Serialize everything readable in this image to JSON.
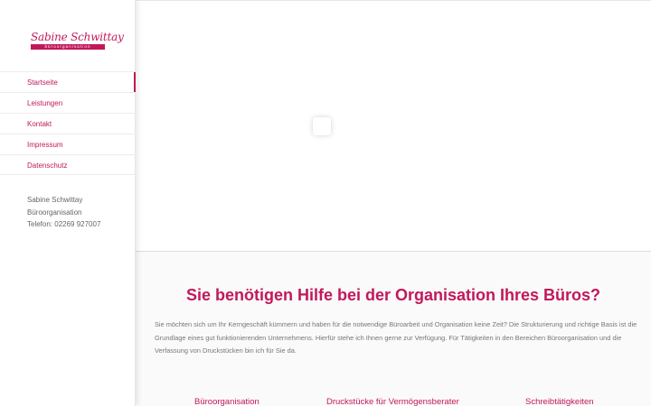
{
  "brand": {
    "name": "Sabine Schwittay",
    "tagline": "büroorganisation"
  },
  "nav": {
    "items": [
      {
        "label": "Startseite",
        "active": true
      },
      {
        "label": "Leistungen",
        "active": false
      },
      {
        "label": "Kontakt",
        "active": false
      },
      {
        "label": "Impressum",
        "active": false
      },
      {
        "label": "Datenschutz",
        "active": false
      }
    ]
  },
  "contact": {
    "name": "Sabine Schwittay",
    "title": "Büroorganisation",
    "phone": "Telefon: 02269 927007"
  },
  "main": {
    "headline": "Sie benötigen Hilfe bei der Organisation Ihres Büros?",
    "intro": "Sie möchten sich um Ihr Kerngeschäft kümmern und haben für die notwendige Büroarbeit und Organisation keine Zeit? Die Strukturierung und richtige Basis ist die Grundlage eines gut funktionierenden Unternehmens. Hierfür stehe ich Ihnen gerne zur Verfügung. Für Tätigkeiten in den Bereichen Büroorganisation und die Verfassung von Druckstücken bin ich für Sie da.",
    "services": [
      "Büroorganisation",
      "Druckstücke für Vermögensberater",
      "Schreibtätigkeiten"
    ]
  },
  "colors": {
    "accent": "#c2185b",
    "text": "#777777",
    "background": "#ffffff"
  }
}
